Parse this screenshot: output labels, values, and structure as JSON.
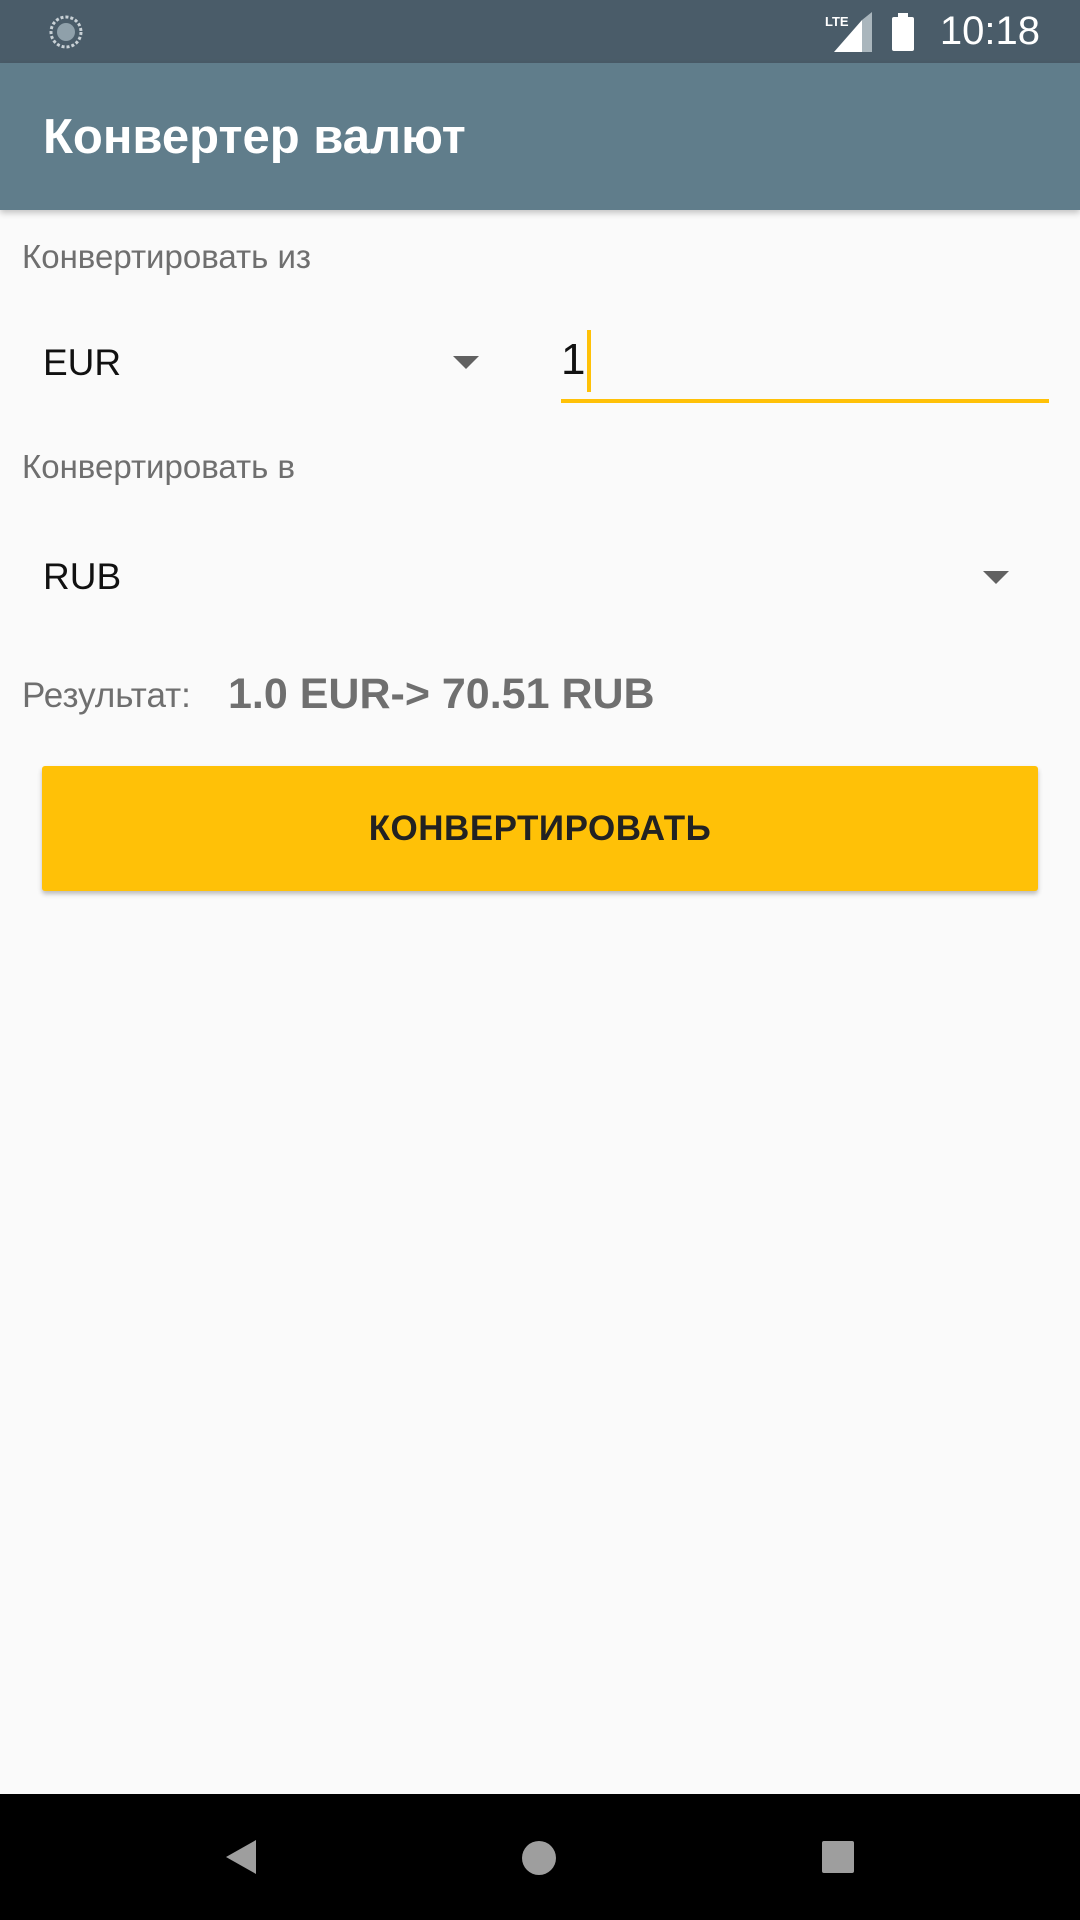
{
  "status_bar": {
    "network_label": "LTE",
    "time": "10:18"
  },
  "app_bar": {
    "title": "Конвертер валют"
  },
  "converter": {
    "from_label": "Конвертировать из",
    "from_currency": "EUR",
    "amount_value": "1",
    "to_label": "Конвертировать в",
    "to_currency": "RUB",
    "result_label": "Результат:",
    "result_value": "1.0 EUR-> 70.51 RUB",
    "convert_button_label": "КОНВЕРТИРОВАТЬ"
  },
  "colors": {
    "status_bar": "#4a5c69",
    "app_bar": "#607d8b",
    "accent": "#ffc107",
    "background": "#fafafa"
  },
  "icons": {
    "status_left": "sync-icon",
    "signal": "lte-signal-icon",
    "battery": "battery-icon",
    "nav_back": "back-icon",
    "nav_home": "home-icon",
    "nav_recents": "recents-icon"
  }
}
